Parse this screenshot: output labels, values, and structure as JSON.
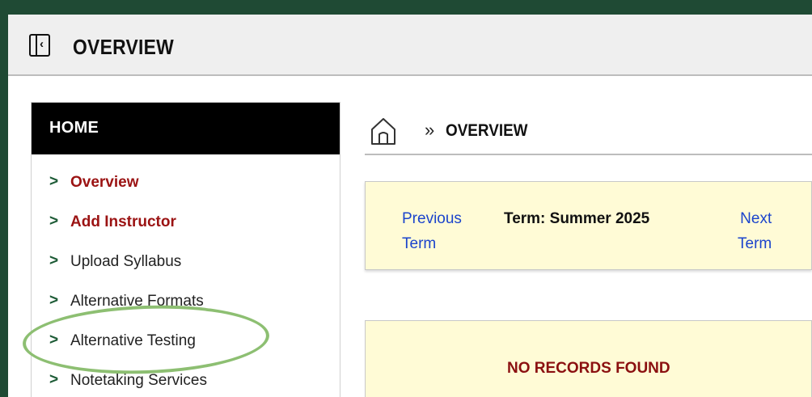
{
  "header": {
    "title": "OVERVIEW",
    "toggle_icon": "sidebar-collapse-icon"
  },
  "sidebar": {
    "heading": "HOME",
    "items": [
      {
        "label": "Overview",
        "style": "active-red"
      },
      {
        "label": "Add Instructor",
        "style": "active-red"
      },
      {
        "label": "Upload Syllabus",
        "style": "normal"
      },
      {
        "label": "Alternative Formats",
        "style": "normal"
      },
      {
        "label": "Alternative Testing",
        "style": "normal",
        "highlighted": true
      },
      {
        "label": "Notetaking Services",
        "style": "normal"
      }
    ],
    "bullet": ">"
  },
  "breadcrumb": {
    "home_icon": "home-icon",
    "separator": "»",
    "current": "OVERVIEW"
  },
  "term": {
    "previous_line1": "Previous",
    "previous_line2": "Term",
    "label": "Term: Summer 2025",
    "next_line1": "Next",
    "next_line2": "Term"
  },
  "records": {
    "message": "NO RECORDS FOUND"
  },
  "colors": {
    "frame_background": "#1f4a34",
    "accent_red": "#9b1313",
    "link_blue": "#1b44cc",
    "notice_yellow": "#fffbd6",
    "highlight_green": "#8dbf72"
  }
}
